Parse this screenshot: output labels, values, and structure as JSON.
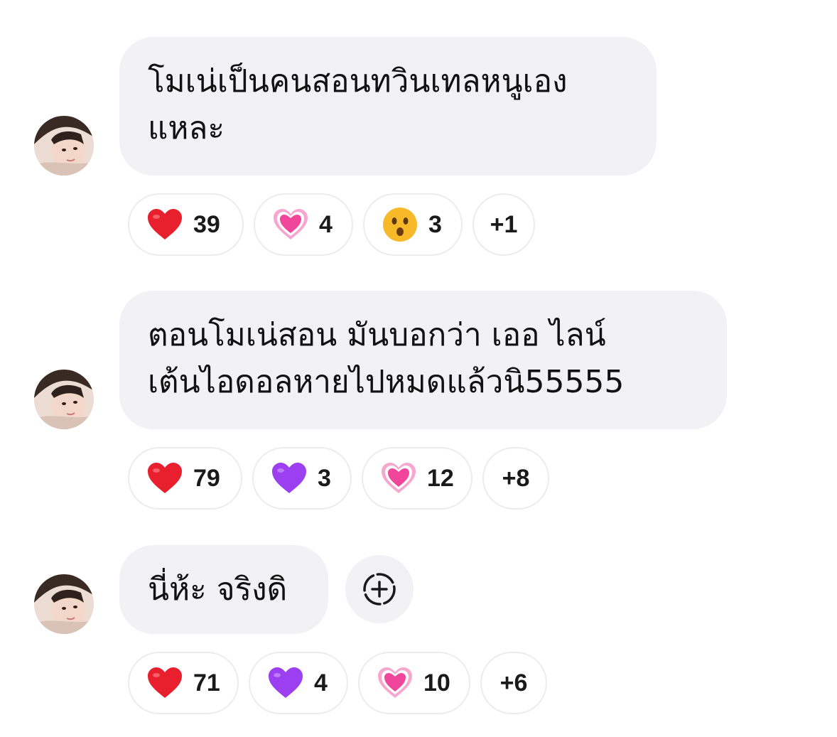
{
  "messages": [
    {
      "lines": [
        "โมเน่เป็นคนสอนทวินเทลหนูเอง",
        "แหละ"
      ],
      "reactions": [
        {
          "icon": "red-heart",
          "count": "39"
        },
        {
          "icon": "growing-heart",
          "count": "4"
        },
        {
          "icon": "surprised-face",
          "count": "3"
        }
      ],
      "more": "+1"
    },
    {
      "lines": [
        "ตอนโมเน่สอน มันบอกว่า เออ ไลน์",
        "เต้นไอดอลหายไปหมดแล้วนิ55555"
      ],
      "reactions": [
        {
          "icon": "red-heart",
          "count": "79"
        },
        {
          "icon": "purple-heart",
          "count": "3"
        },
        {
          "icon": "growing-heart",
          "count": "12"
        }
      ],
      "more": "+8"
    },
    {
      "lines": [
        "นี่ห้ะ จริงดิ"
      ],
      "reactions": [
        {
          "icon": "red-heart",
          "count": "71"
        },
        {
          "icon": "purple-heart",
          "count": "4"
        },
        {
          "icon": "growing-heart",
          "count": "10"
        }
      ],
      "more": "+6",
      "add_reaction_icon": "add-reaction-icon"
    }
  ],
  "colors": {
    "bubble": "#f2f2f4",
    "chip_border": "#ececee",
    "red_heart": "#e8202e",
    "purple_heart": "#9b3ff0",
    "pink_heart": "#f0469c",
    "face": "#f7b928"
  }
}
